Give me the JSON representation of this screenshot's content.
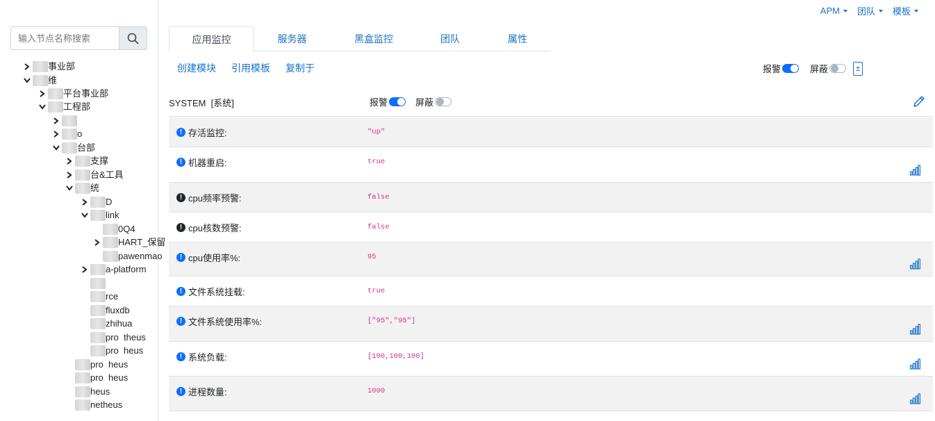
{
  "topnav": [
    {
      "label": "APM"
    },
    {
      "label": "团队"
    },
    {
      "label": "模板"
    }
  ],
  "sidebar": {
    "search_placeholder": "输入节点名称搜索",
    "tree": [
      {
        "label": "事业部",
        "indent": 1,
        "chev": "right"
      },
      {
        "label": "维",
        "indent": 1,
        "chev": "down"
      },
      {
        "label": "平台事业部",
        "indent": 2,
        "chev": "right"
      },
      {
        "label": "工程部",
        "indent": 2,
        "chev": "down"
      },
      {
        "label": "",
        "indent": 3,
        "chev": "right"
      },
      {
        "label": "o",
        "indent": 3,
        "chev": "right"
      },
      {
        "label": "台部",
        "indent": 3,
        "chev": "down"
      },
      {
        "label": "支撑",
        "indent": 4,
        "chev": "right"
      },
      {
        "label": "台&工具",
        "indent": 4,
        "chev": "right"
      },
      {
        "label": "统",
        "indent": 4,
        "chev": "down"
      },
      {
        "label": "D",
        "indent": 5,
        "chev": "right"
      },
      {
        "label": "link",
        "indent": 5,
        "chev": "down"
      },
      {
        "label": "0Q4",
        "indent": 6,
        "chev": ""
      },
      {
        "label": "HART_保留",
        "indent": 6,
        "chev": "right"
      },
      {
        "label": "pawenmao",
        "indent": 6,
        "chev": ""
      },
      {
        "label": "a-platform",
        "indent": 5,
        "chev": "right"
      },
      {
        "label": "",
        "indent": 5,
        "chev": ""
      },
      {
        "label": "rce",
        "indent": 5,
        "chev": ""
      },
      {
        "label": "fluxdb",
        "indent": 5,
        "chev": ""
      },
      {
        "label": "zhihua",
        "indent": 5,
        "chev": ""
      },
      {
        "label": "pro  theus",
        "indent": 5,
        "chev": ""
      },
      {
        "label": "pro  heus",
        "indent": 5,
        "chev": ""
      },
      {
        "label": "pro  heus",
        "indent": 4,
        "chev": ""
      },
      {
        "label": "pro  heus",
        "indent": 4,
        "chev": ""
      },
      {
        "label": "heus",
        "indent": 4,
        "chev": ""
      },
      {
        "label": "netheus",
        "indent": 4,
        "chev": ""
      }
    ]
  },
  "tabs": [
    {
      "label": "应用监控",
      "active": true
    },
    {
      "label": "服务器"
    },
    {
      "label": "黑盒监控"
    },
    {
      "label": "团队"
    },
    {
      "label": "属性"
    }
  ],
  "actions": {
    "create": "创建模块",
    "ref": "引用模板",
    "copy": "复制于"
  },
  "top_toggles": {
    "alarm_label": "报警",
    "alarm_on": true,
    "mask_label": "屏蔽",
    "mask_on": false,
    "pm_symbol": "±"
  },
  "section": {
    "title": "SYSTEM  [系统]",
    "alarm_label": "报警",
    "alarm_on": true,
    "mask_label": "屏蔽",
    "mask_on": false
  },
  "rows": [
    {
      "label": "存活监控:",
      "value": "\"up\"",
      "info": "blue",
      "chart": false
    },
    {
      "label": "机器重启:",
      "value": "true",
      "info": "blue",
      "chart": true
    },
    {
      "label": "cpu频率预警:",
      "value": "false",
      "info": "dark",
      "chart": false
    },
    {
      "label": "cpu核数预警:",
      "value": "false",
      "info": "dark",
      "chart": false
    },
    {
      "label": "cpu使用率%:",
      "value": "95",
      "info": "blue",
      "chart": true
    },
    {
      "label": "文件系统挂载:",
      "value": "true",
      "info": "blue",
      "chart": false
    },
    {
      "label": "文件系统使用率%:",
      "value": "[\"95\",\"95\"]",
      "info": "blue",
      "chart": true
    },
    {
      "label": "系统负载:",
      "value": "[100,100,100]",
      "info": "blue",
      "chart": true
    },
    {
      "label": "进程数量:",
      "value": "1000",
      "info": "blue",
      "chart": true
    }
  ]
}
